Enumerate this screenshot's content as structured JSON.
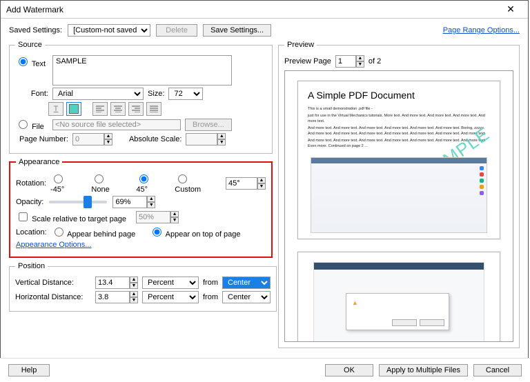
{
  "title": "Add Watermark",
  "top": {
    "saved_settings_label": "Saved Settings:",
    "saved_settings_value": "[Custom-not saved]",
    "delete": "Delete",
    "save_settings": "Save Settings...",
    "page_range_link": "Page Range Options..."
  },
  "source": {
    "legend": "Source",
    "text_label": "Text",
    "text_value": "SAMPLE",
    "font_label": "Font:",
    "font_value": "Arial",
    "size_label": "Size:",
    "size_value": "72",
    "icons": {
      "underline": "T",
      "color": "color",
      "align_left": "align-left",
      "align_center": "align-center",
      "align_right": "align-right",
      "align_justify": "align-justify"
    },
    "file_label": "File",
    "file_value": "<No source file selected>",
    "browse": "Browse...",
    "page_number_label": "Page Number:",
    "page_number_value": "0",
    "absolute_scale_label": "Absolute Scale:",
    "absolute_scale_value": ""
  },
  "appearance": {
    "legend": "Appearance",
    "rotation_label": "Rotation:",
    "rot_m45": "-45°",
    "rot_none": "None",
    "rot_45": "45°",
    "rot_custom": "Custom",
    "rot_value": "45°",
    "opacity_label": "Opacity:",
    "opacity_value": "69%",
    "opacity_slider": 69,
    "scale_label": "Scale relative to target page",
    "scale_value": "50%",
    "location_label": "Location:",
    "loc_behind": "Appear behind page",
    "loc_top": "Appear on top of page",
    "options_link": "Appearance Options..."
  },
  "position": {
    "legend": "Position",
    "vdist_label": "Vertical Distance:",
    "vdist_value": "13.4",
    "hdist_label": "Horizontal Distance:",
    "hdist_value": "3.8",
    "unit": "Percent",
    "from_label": "from",
    "from_value": "Center"
  },
  "preview": {
    "legend": "Preview",
    "page_label": "Preview Page",
    "page_value": "1",
    "of_label": "of 2",
    "doc_title": "A Simple PDF Document",
    "watermark_text": "SAMPLE",
    "para1": "This is a small demonstration .pdf file -",
    "para2": "just for use in the Virtual Mechanics tutorials. More text. And more text. And more text. And more text. And more text.",
    "para3": "And more text. And more text. And more text. And more text. And more text. And more text. Boring, zzzzz. And more text. And more text. And more text. And more text. And more text. And more text. And more text.",
    "para4": "And more text. And more text. And more text. And more text. And more text. And more text. And more text. Even more. Continued on page 2 ..."
  },
  "buttons": {
    "help": "Help",
    "ok": "OK",
    "apply_multiple": "Apply to Multiple Files",
    "cancel": "Cancel"
  }
}
